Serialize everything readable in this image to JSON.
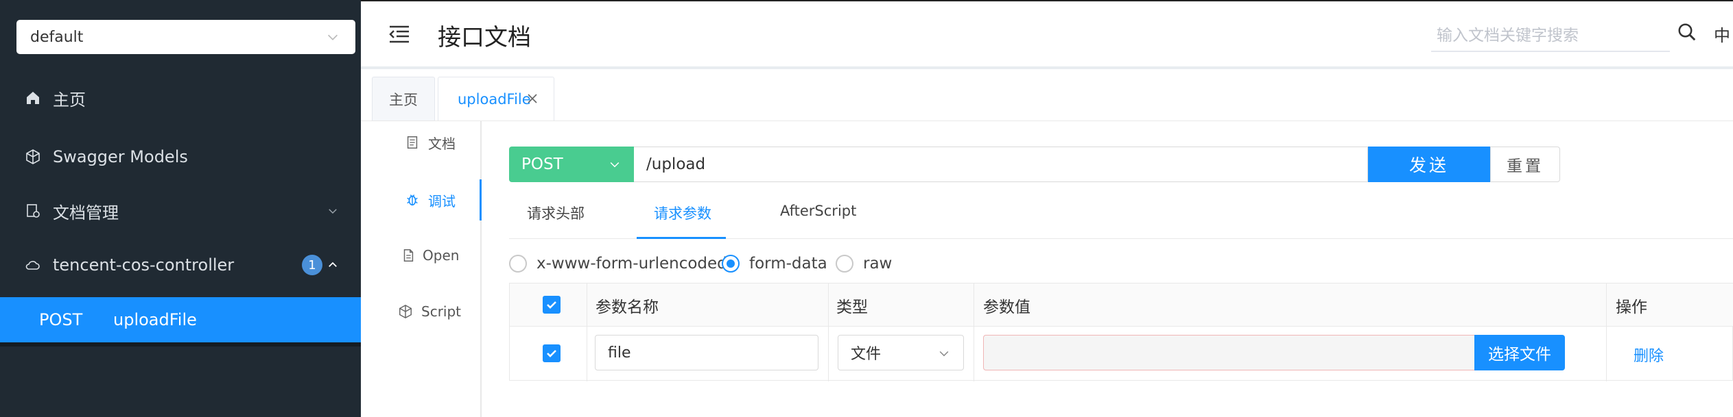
{
  "sidebar": {
    "group_select": "default",
    "menu": [
      {
        "label": "主页",
        "icon": "home-icon"
      },
      {
        "label": "Swagger Models",
        "icon": "cube-icon"
      },
      {
        "label": "文档管理",
        "icon": "docs-manage-icon"
      },
      {
        "label": "tencent-cos-controller",
        "icon": "cloud-icon",
        "badge": "1"
      }
    ],
    "active_sub": {
      "method": "POST",
      "name": "uploadFile"
    }
  },
  "header": {
    "title": "接口文档",
    "search_placeholder": "输入文档关键字搜索",
    "lang": "中"
  },
  "tabs": [
    {
      "label": "主页"
    },
    {
      "label": "uploadFile",
      "active": true
    }
  ],
  "vtabs": [
    {
      "label": "文档",
      "icon": "document-icon"
    },
    {
      "label": "调试",
      "icon": "bug-icon",
      "active": true
    },
    {
      "label": "Open",
      "icon": "file-icon"
    },
    {
      "label": "Script",
      "icon": "script-icon"
    }
  ],
  "request": {
    "method": "POST",
    "url": "/upload",
    "send_label": "发送",
    "reset_label": "重置"
  },
  "param_tabs": [
    {
      "label": "请求头部"
    },
    {
      "label": "请求参数",
      "active": true
    },
    {
      "label": "AfterScript"
    }
  ],
  "body_types": [
    {
      "label": "x-www-form-urlencoded",
      "checked": false
    },
    {
      "label": "form-data",
      "checked": true
    },
    {
      "label": "raw",
      "checked": false
    }
  ],
  "table": {
    "headers": [
      "参数名称",
      "类型",
      "参数值",
      "操作"
    ],
    "rows": [
      {
        "name": "file",
        "type": "文件",
        "value": "",
        "choose_label": "选择文件",
        "action": "删除"
      }
    ]
  },
  "colors": {
    "sidebar_bg": "#202a33",
    "accent": "#1890ff",
    "post_green": "#49cc90"
  }
}
